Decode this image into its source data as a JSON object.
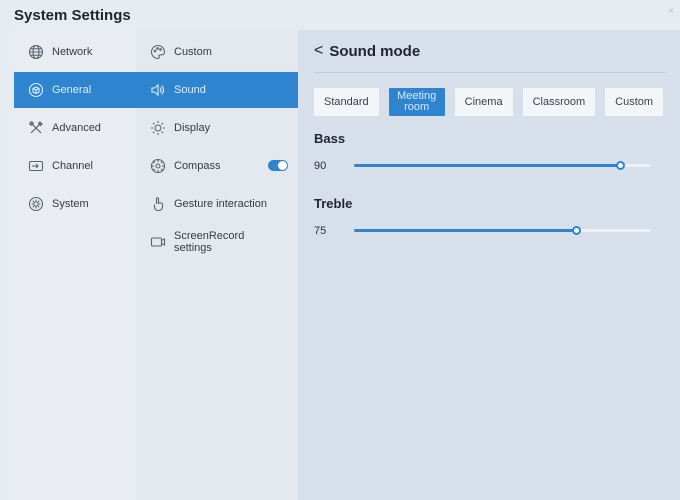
{
  "app": {
    "title": "System Settings",
    "close_glyph": "×"
  },
  "colors": {
    "accent": "#2f84d0",
    "active_text": "#dfeefc"
  },
  "sidebar": {
    "items": [
      {
        "label": "Network",
        "icon": "globe-icon",
        "active": false
      },
      {
        "label": "General",
        "icon": "cube-icon",
        "active": true
      },
      {
        "label": "Advanced",
        "icon": "tools-icon",
        "active": false
      },
      {
        "label": "Channel",
        "icon": "input-icon",
        "active": false
      },
      {
        "label": "System",
        "icon": "gear-icon",
        "active": false
      }
    ]
  },
  "submenu": {
    "items": [
      {
        "label": "Custom",
        "icon": "palette-icon",
        "active": false
      },
      {
        "label": "Sound",
        "icon": "speaker-icon",
        "active": true
      },
      {
        "label": "Display",
        "icon": "sun-icon",
        "active": false
      },
      {
        "label": "Compass",
        "icon": "compass-icon",
        "active": false,
        "toggle": true
      },
      {
        "label": "Gesture interaction",
        "icon": "hand-icon",
        "active": false
      },
      {
        "label": "ScreenRecord\nsettings",
        "icon": "record-icon",
        "active": false
      }
    ]
  },
  "panel": {
    "back_glyph": "<",
    "title": "Sound mode",
    "modes": [
      {
        "label": "Standard",
        "active": false
      },
      {
        "label": "Meeting\nroom",
        "active": true
      },
      {
        "label": "Cinema",
        "active": false
      },
      {
        "label": "Classroom",
        "active": false
      },
      {
        "label": "Custom",
        "active": false
      }
    ],
    "bass": {
      "label": "Bass",
      "value": 90,
      "value_text": "90",
      "max": 100
    },
    "treble": {
      "label": "Treble",
      "value": 75,
      "value_text": "75",
      "max": 100
    }
  }
}
